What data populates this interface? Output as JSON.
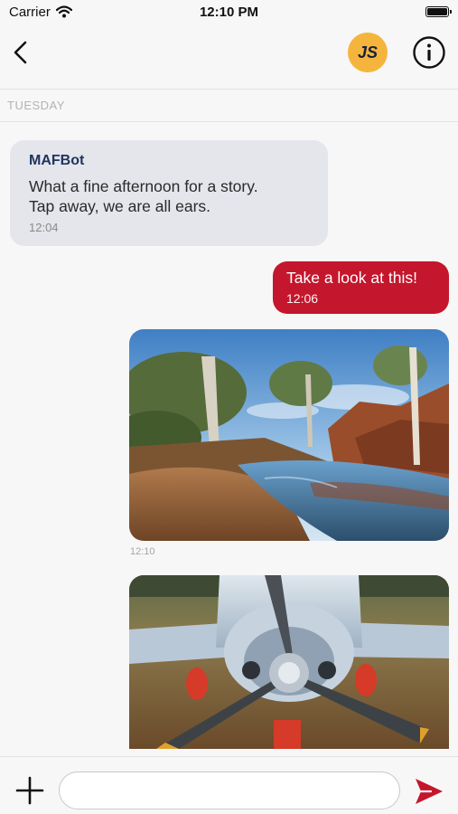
{
  "status_bar": {
    "carrier": "Carrier",
    "time": "12:10 PM"
  },
  "nav": {
    "avatar_initials": "JS",
    "icons": [
      "chevron-left-icon",
      "info-icon"
    ]
  },
  "day_label": "TUESDAY",
  "messages": [
    {
      "type": "incoming",
      "sender": "MAFBot",
      "lines": [
        "What a fine afternoon for a story.",
        "Tap away, we are all ears."
      ],
      "time": "12:04"
    },
    {
      "type": "outgoing",
      "text": "Take a look at this!",
      "time": "12:06"
    },
    {
      "type": "image",
      "subject": "outback waterhole with gum trees",
      "time": "12:10"
    },
    {
      "type": "image",
      "subject": "light aircraft propeller close-up"
    }
  ],
  "composer": {
    "placeholder": "",
    "icons": [
      "plus-icon",
      "send-icon"
    ]
  },
  "colors": {
    "accent": "#c4162c",
    "avatar": "#f5b53d",
    "bubble_in": "#e5e5ec",
    "sender": "#1f3560"
  }
}
